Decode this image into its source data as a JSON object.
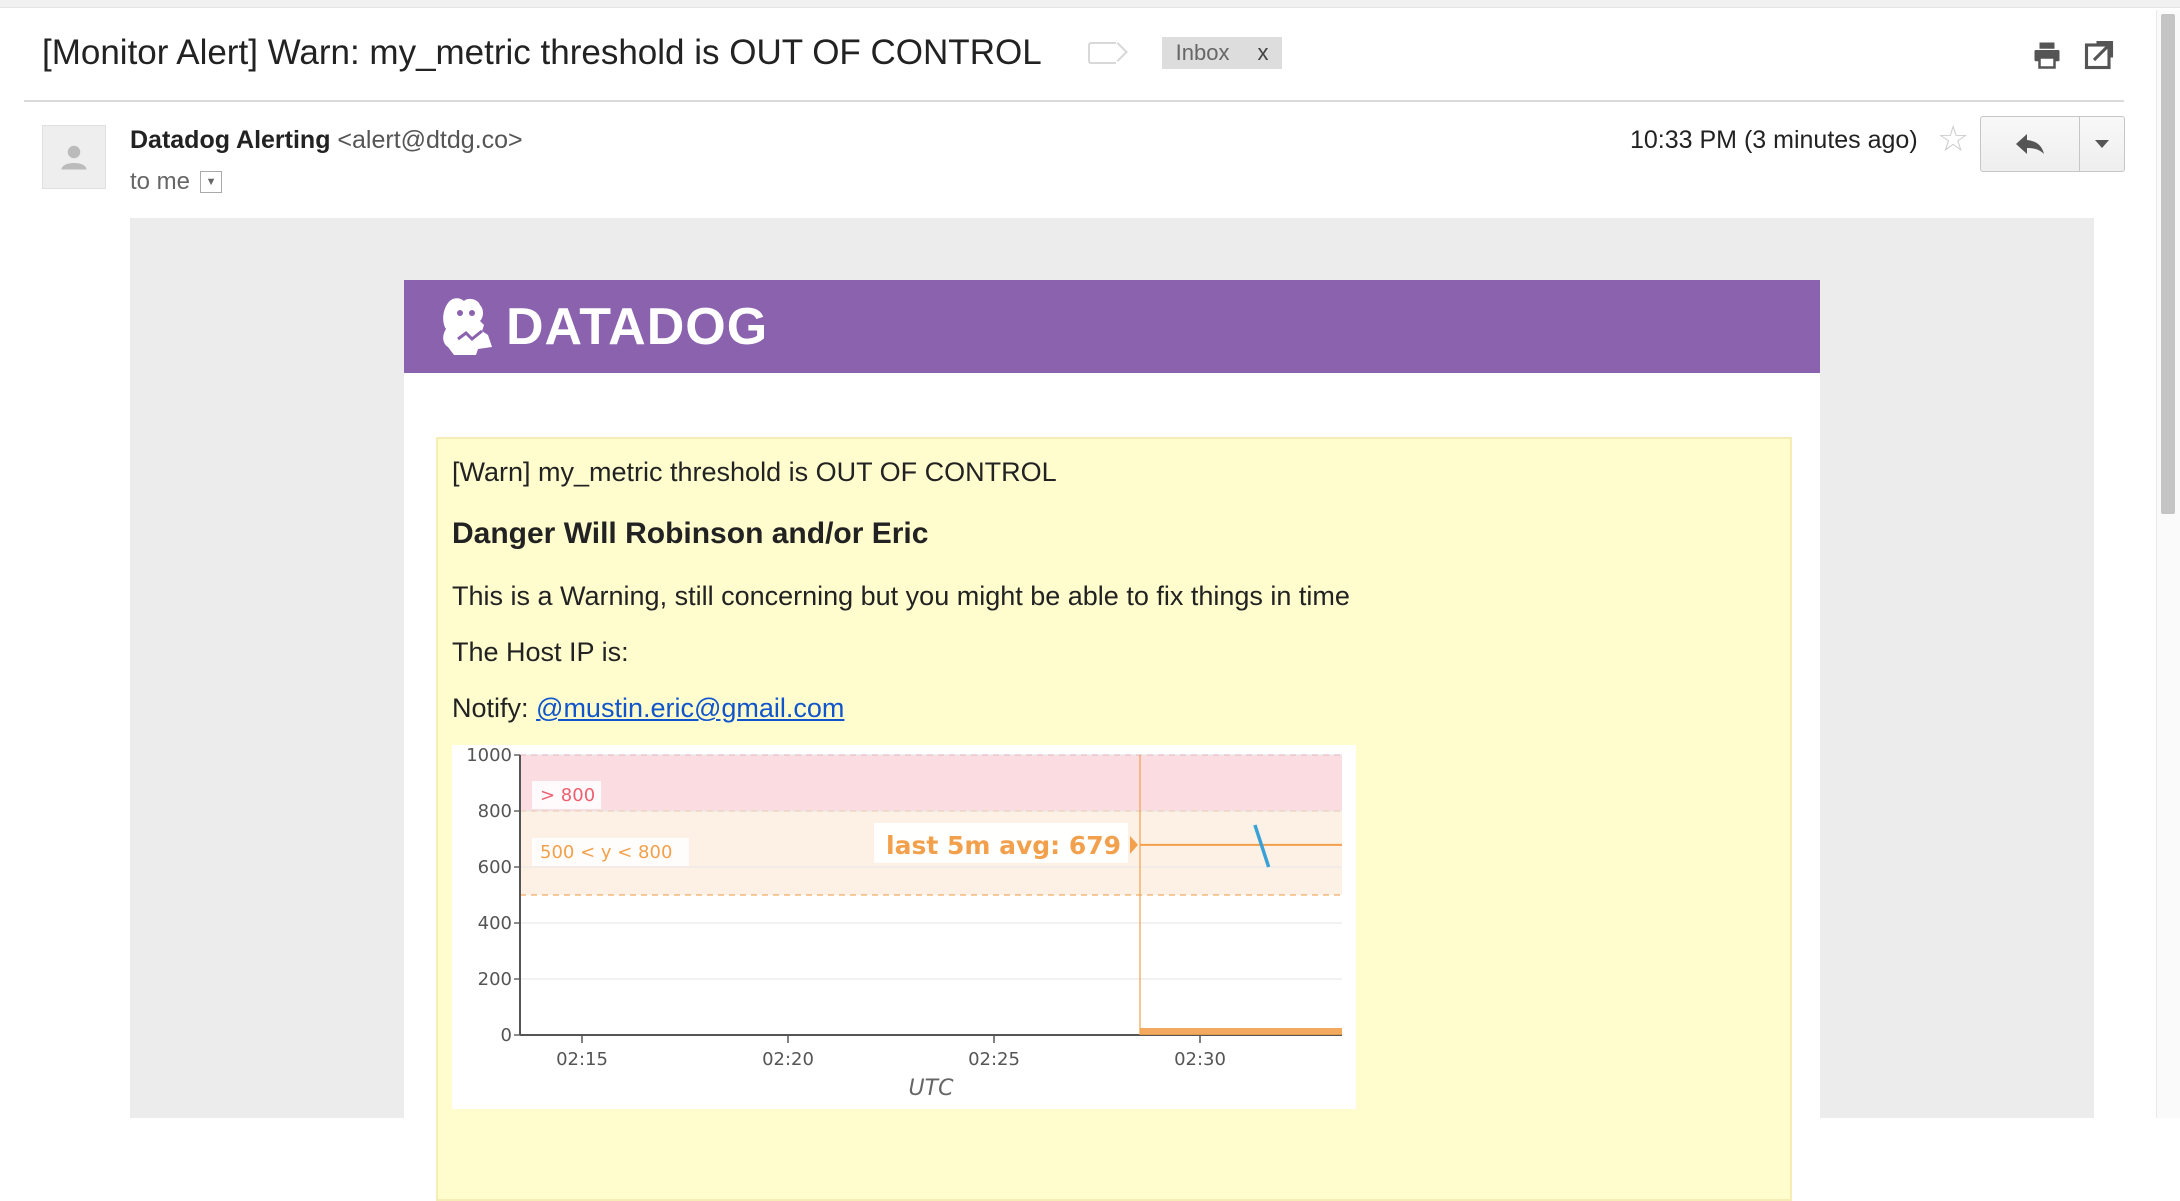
{
  "email": {
    "subject": "[Monitor Alert] Warn: my_metric threshold is OUT OF CONTROL",
    "label": "Inbox",
    "label_remove": "x",
    "sender_name": "Datadog Alerting",
    "sender_email": "<alert@dtdg.co>",
    "to": "to me",
    "time": "10:33 PM (3 minutes ago)"
  },
  "icons": {
    "print": "printer-icon",
    "new_window": "new-window-icon",
    "star": "star-icon",
    "reply": "reply-icon",
    "more": "dropdown-arrow-icon"
  },
  "banner": {
    "logo_text": "DATADOG",
    "color": "#8a62ae"
  },
  "alert": {
    "title": "[Warn] my_metric threshold is OUT OF CONTROL",
    "heading": "Danger Will Robinson and/or Eric",
    "message": "This is a Warning, still concerning but you might be able to fix things in time",
    "host_line": "The Host IP is:",
    "notify_label": "Notify: ",
    "notify_link": "@mustin.eric@gmail.com",
    "background": "#fffdcd"
  },
  "chart_data": {
    "type": "line",
    "xlabel": "UTC",
    "x_ticks": [
      "02:15",
      "02:20",
      "02:25",
      "02:30"
    ],
    "y_ticks": [
      0,
      200,
      400,
      600,
      800,
      1000
    ],
    "ylim": [
      0,
      1000
    ],
    "grid": true,
    "thresholds": [
      {
        "label": "> 800",
        "from": 800,
        "to": 1000,
        "color": "#f6c0c8",
        "text_color": "#ee5f70"
      },
      {
        "label": "500 < y < 800",
        "from": 500,
        "to": 800,
        "color": "#fbe3cf",
        "text_color": "#f2a04c"
      }
    ],
    "annotation": "last 5m avg: 679",
    "avg_value": 679,
    "series": [
      {
        "x": [
          "02:31:20",
          "02:31:40"
        ],
        "values": [
          750,
          600
        ],
        "color": "#3aa1d6"
      }
    ]
  }
}
